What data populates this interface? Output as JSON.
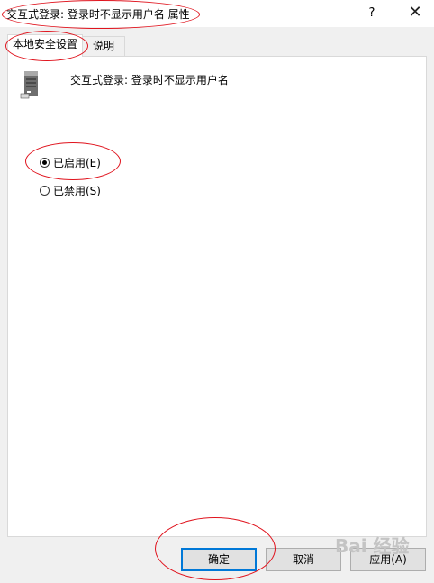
{
  "window": {
    "title": "交互式登录: 登录时不显示用户名 属性",
    "help_label": "?",
    "close_label": "✕"
  },
  "tabs": [
    {
      "label": "本地安全设置",
      "active": true
    },
    {
      "label": "说明",
      "active": false
    }
  ],
  "policy": {
    "icon": "server-icon",
    "title": "交互式登录: 登录时不显示用户名"
  },
  "options": [
    {
      "label": "已启用(E)",
      "selected": true
    },
    {
      "label": "已禁用(S)",
      "selected": false
    }
  ],
  "buttons": {
    "ok": "确定",
    "cancel": "取消",
    "apply": "应用(A)"
  },
  "annotation_color": "#e0141e",
  "watermark": "Bai 经验"
}
